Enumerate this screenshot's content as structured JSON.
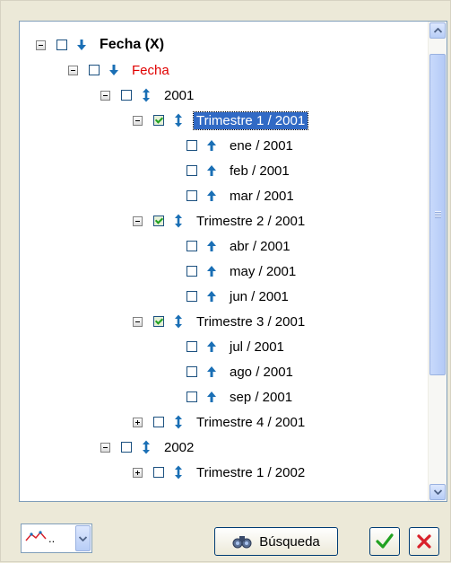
{
  "tree": {
    "rows": [
      {
        "label": "Fecha (X)",
        "expander": "minus",
        "checked": false,
        "arrow": "down",
        "style": "bold"
      },
      {
        "label": "Fecha",
        "expander": "minus",
        "checked": false,
        "arrow": "down",
        "style": "red"
      },
      {
        "label": "2001",
        "expander": "minus",
        "checked": false,
        "arrow": "updown",
        "style": "normal"
      },
      {
        "label": "Trimestre 1 / 2001",
        "expander": "minus",
        "checked": true,
        "arrow": "updown",
        "style": "selected"
      },
      {
        "label": "ene / 2001",
        "expander": "none",
        "checked": false,
        "arrow": "up",
        "style": "normal"
      },
      {
        "label": "feb / 2001",
        "expander": "none",
        "checked": false,
        "arrow": "up",
        "style": "normal"
      },
      {
        "label": "mar / 2001",
        "expander": "none",
        "checked": false,
        "arrow": "up",
        "style": "normal"
      },
      {
        "label": "Trimestre 2 / 2001",
        "expander": "minus",
        "checked": true,
        "arrow": "updown",
        "style": "normal"
      },
      {
        "label": "abr / 2001",
        "expander": "none",
        "checked": false,
        "arrow": "up",
        "style": "normal"
      },
      {
        "label": "may / 2001",
        "expander": "none",
        "checked": false,
        "arrow": "up",
        "style": "normal"
      },
      {
        "label": "jun / 2001",
        "expander": "none",
        "checked": false,
        "arrow": "up",
        "style": "normal"
      },
      {
        "label": "Trimestre 3 / 2001",
        "expander": "minus",
        "checked": true,
        "arrow": "updown",
        "style": "normal"
      },
      {
        "label": "jul / 2001",
        "expander": "none",
        "checked": false,
        "arrow": "up",
        "style": "normal"
      },
      {
        "label": "ago / 2001",
        "expander": "none",
        "checked": false,
        "arrow": "up",
        "style": "normal"
      },
      {
        "label": "sep / 2001",
        "expander": "none",
        "checked": false,
        "arrow": "up",
        "style": "normal"
      },
      {
        "label": "Trimestre 4 / 2001",
        "expander": "plus",
        "checked": false,
        "arrow": "updown",
        "style": "normal"
      },
      {
        "label": "2002",
        "expander": "minus",
        "checked": false,
        "arrow": "updown",
        "style": "normal"
      },
      {
        "label": "Trimestre 1 / 2002",
        "expander": "plus",
        "checked": false,
        "arrow": "updown",
        "style": "normal"
      }
    ]
  },
  "footer": {
    "line_type_value": "..",
    "search_label": "Búsqueda"
  },
  "colors": {
    "arrow_blue": "#1a6fb5",
    "selection": "#316ac5",
    "red_label": "#e00000",
    "ok_green": "#21a121",
    "cancel_red": "#d9202a"
  },
  "icons": {
    "ok": "check-icon",
    "cancel": "x-icon",
    "search": "binoculars-icon",
    "line_type": "line-chart-icon"
  }
}
